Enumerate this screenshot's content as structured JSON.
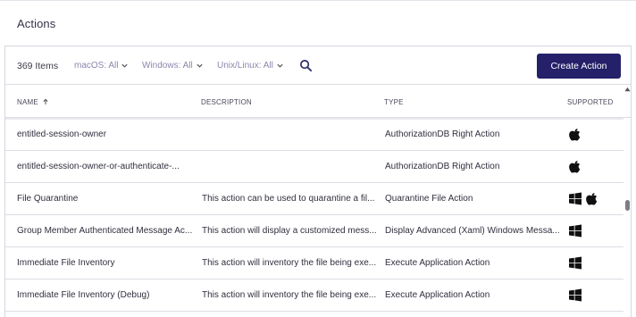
{
  "page": {
    "title": "Actions"
  },
  "toolbar": {
    "count": "369 Items",
    "filters": [
      "macOS: All",
      "Windows: All",
      "Unix/Linux: All"
    ],
    "create_button": "Create Action"
  },
  "table": {
    "headers": {
      "name": "NAME",
      "description": "DESCRIPTION",
      "type": "TYPE",
      "supported": "SUPPORTED"
    },
    "rows": [
      {
        "name": "entitled-session-owner",
        "description": "",
        "type": "AuthorizationDB Right Action",
        "supported": [
          "apple"
        ]
      },
      {
        "name": "entitled-session-owner-or-authenticate-...",
        "description": "",
        "type": "AuthorizationDB Right Action",
        "supported": [
          "apple"
        ]
      },
      {
        "name": "File Quarantine",
        "description": "This action can be used to quarantine a fil...",
        "type": "Quarantine File Action",
        "supported": [
          "windows",
          "apple"
        ]
      },
      {
        "name": "Group Member Authenticated Message Ac...",
        "description": "This action will display a customized mess...",
        "type": "Display Advanced (Xaml) Windows Messa...",
        "supported": [
          "windows"
        ]
      },
      {
        "name": "Immediate File Inventory",
        "description": "This action will inventory the file being exe...",
        "type": "Execute Application Action",
        "supported": [
          "windows"
        ]
      },
      {
        "name": "Immediate File Inventory (Debug)",
        "description": "This action will inventory the file being exe...",
        "type": "Execute Application Action",
        "supported": [
          "windows"
        ]
      }
    ]
  },
  "colors": {
    "accent_button": "#24206a",
    "filter_text": "#8d86ad"
  }
}
